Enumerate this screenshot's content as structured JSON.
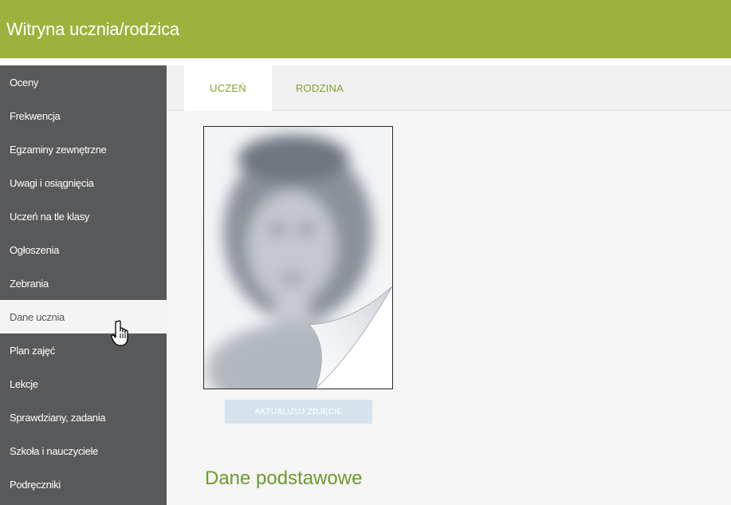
{
  "header": {
    "title": "Witryna ucznia/rodzica",
    "color": "#9bb33d"
  },
  "sidebar": {
    "background": "#58595b",
    "items": [
      {
        "label": "Oceny",
        "active": false
      },
      {
        "label": "Frekwencja",
        "active": false
      },
      {
        "label": "Egzaminy zewnętrzne",
        "active": false
      },
      {
        "label": "Uwagi i osiągnięcia",
        "active": false
      },
      {
        "label": "Uczeń na tle klasy",
        "active": false
      },
      {
        "label": "Ogłoszenia",
        "active": false
      },
      {
        "label": "Zebrania",
        "active": false
      },
      {
        "label": "Dane ucznia",
        "active": true
      },
      {
        "label": "Plan zajęć",
        "active": false
      },
      {
        "label": "Lekcje",
        "active": false
      },
      {
        "label": "Sprawdziany, zadania",
        "active": false
      },
      {
        "label": "Szkoła i nauczyciele",
        "active": false
      },
      {
        "label": "Podręczniki",
        "active": false
      }
    ]
  },
  "cursor": {
    "icon": "hand-pointer-icon"
  },
  "main": {
    "tabs": [
      {
        "label": "UCZEŃ",
        "active": true
      },
      {
        "label": "RODZINA",
        "active": false
      }
    ],
    "photo": {
      "icon": "student-photo-placeholder"
    },
    "update_photo_label": "AKTUALIZUJ ZDJĘCIE",
    "section_title": "Dane podstawowe",
    "accent_color": "#7fa12a"
  }
}
